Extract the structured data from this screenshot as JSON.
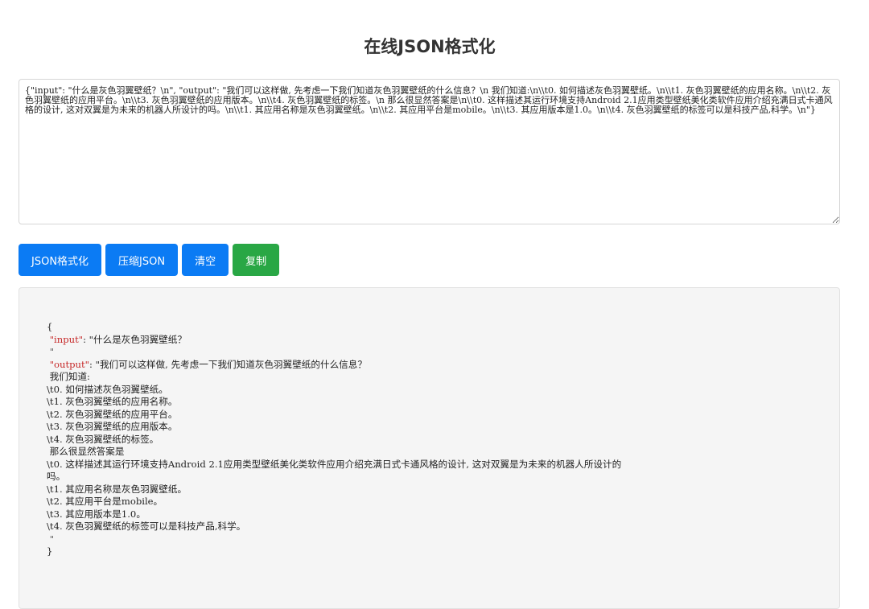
{
  "page": {
    "title": "在线JSON格式化"
  },
  "input": {
    "value": "{\"input\": \"什么是灰色羽翼壁纸？\\n\", \"output\": \"我们可以这样做, 先考虑一下我们知道灰色羽翼壁纸的什么信息？\\n 我们知道:\\n\\\\t0. 如何描述灰色羽翼壁纸。\\n\\\\t1. 灰色羽翼壁纸的应用名称。\\n\\\\t2. 灰色羽翼壁纸的应用平台。\\n\\\\t3. 灰色羽翼壁纸的应用版本。\\n\\\\t4. 灰色羽翼壁纸的标签。\\n 那么很显然答案是\\n\\\\t0. 这样描述其运行环境支持Android 2.1应用类型壁纸美化类软件应用介绍充满日式卡通风格的设计, 这对双翼是为未来的机器人所设计的吗。\\n\\\\t1. 其应用名称是灰色羽翼壁纸。\\n\\\\t2. 其应用平台是mobile。\\n\\\\t3. 其应用版本是1.0。\\n\\\\t4. 灰色羽翼壁纸的标签可以是科技产品,科学。\\n\"}"
  },
  "buttons": {
    "format": "JSON格式化",
    "compress": "压缩JSON",
    "clear": "清空",
    "copy": "复制"
  },
  "output": {
    "open_brace": "{",
    "close_brace": "}",
    "input_key": "\"input\"",
    "input_value": "\"什么是灰色羽翼壁纸？",
    "input_value_end": "\"",
    "output_key": "\"output\"",
    "output_value_first": "\"我们可以这样做, 先考虑一下我们知道灰色羽翼壁纸的什么信息？",
    "output_lines": [
      " 我们知道:",
      "\\t0. 如何描述灰色羽翼壁纸。",
      "\\t1. 灰色羽翼壁纸的应用名称。",
      "\\t2. 灰色羽翼壁纸的应用平台。",
      "\\t3. 灰色羽翼壁纸的应用版本。",
      "\\t4. 灰色羽翼壁纸的标签。",
      " 那么很显然答案是",
      "\\t0. 这样描述其运行环境支持Android 2.1应用类型壁纸美化类软件应用介绍充满日式卡通风格的设计, 这对双翼是为未来的机器人所设计的",
      "吗。",
      "\\t1. 其应用名称是灰色羽翼壁纸。",
      "\\t2. 其应用平台是mobile。",
      "\\t3. 其应用版本是1.0。",
      "\\t4. 灰色羽翼壁纸的标签可以是科技产品,科学。"
    ],
    "output_value_end": "\""
  },
  "colors": {
    "primary_button": "#0b7bf4",
    "copy_button": "#29a745",
    "json_key": "#c62828"
  }
}
